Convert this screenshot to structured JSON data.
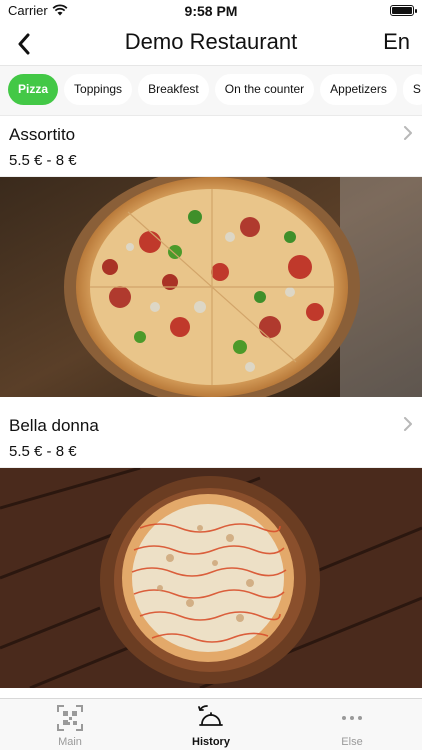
{
  "status_bar": {
    "carrier": "Carrier",
    "time": "9:58 PM"
  },
  "nav": {
    "title": "Demo Restaurant",
    "language": "En",
    "back_icon": "chevron-left-icon"
  },
  "categories": [
    {
      "label": "Pizza",
      "active": true
    },
    {
      "label": "Toppings",
      "active": false
    },
    {
      "label": "Breakfest",
      "active": false
    },
    {
      "label": "On the counter",
      "active": false
    },
    {
      "label": "Appetizers",
      "active": false
    },
    {
      "label": "S",
      "active": false
    }
  ],
  "items": [
    {
      "name": "Assortito",
      "price": "5.5 €  -  8 €"
    },
    {
      "name": "Bella donna",
      "price": "5.5 €  -  8 €"
    }
  ],
  "tabs": [
    {
      "label": "Main",
      "icon": "qr-code-icon",
      "active": false
    },
    {
      "label": "History",
      "icon": "cloche-icon",
      "active": true
    },
    {
      "label": "Else",
      "icon": "more-dots-icon",
      "active": false
    }
  ],
  "colors": {
    "accent": "#43c846",
    "inactive_tab": "#9a9a9a"
  }
}
